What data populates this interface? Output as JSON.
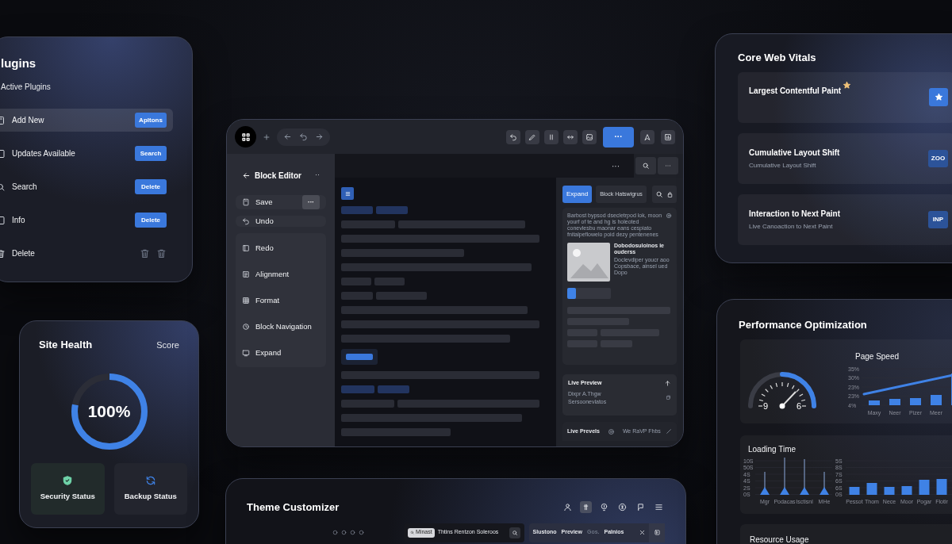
{
  "plugins": {
    "title": "lugins",
    "subtitle": "Active Plugins",
    "rows": [
      {
        "label": "Add New",
        "selected": true,
        "action": "Apltons"
      },
      {
        "label": "Updates Available",
        "selected": false,
        "action": "Search"
      },
      {
        "label": "Search",
        "selected": false,
        "action": "Delete"
      },
      {
        "label": "Info",
        "selected": false,
        "action": "Delete"
      },
      {
        "label": "Delete",
        "selected": false,
        "kind": "trash"
      }
    ]
  },
  "site_health": {
    "title": "Site Health",
    "score_label": "Score",
    "score": "100%",
    "tiles": [
      {
        "label": "Security Status",
        "kind": "security"
      },
      {
        "label": "Backup Status",
        "kind": "backup"
      }
    ]
  },
  "editor": {
    "toolbar_primary": "···",
    "sidebar": {
      "title": "Block Editor",
      "menu": "··",
      "groups": [
        [
          {
            "label": "Save",
            "more": "···"
          }
        ],
        [
          {
            "label": "Undo"
          }
        ],
        [
          {
            "label": "Redo"
          },
          {
            "label": "Alignment"
          },
          {
            "label": "Format"
          },
          {
            "label": "Block Navigation"
          },
          {
            "label": "Expand"
          }
        ]
      ]
    },
    "canvas_menu": "···",
    "inspector": {
      "tabs": [
        {
          "label": "Expand",
          "selected": true
        },
        {
          "label": "Block Hatswigrus",
          "selected": false
        }
      ],
      "description": "Barbost bypsod dsecletrpod lok, moon yourf of te and hg is holeoted conevlesbu maonar eans cespiato fnitalpeflowelo poid dezy pentenenes",
      "media_title": "Dobodosuloinos ie ouderss",
      "media_text": "Doclevdiper youcr aoo Copsbace, ainsel ued Dopo",
      "level": 0.2,
      "live_preview": {
        "title": "Live Preview",
        "lines": [
          "Dixpr A.Thgw",
          "Sersoonevlatos"
        ]
      },
      "footer": [
        "Live Prevels",
        "We RaVP Fhbs"
      ]
    }
  },
  "theme_customizer": {
    "title": "Theme Customizer",
    "search_chip": "Minast",
    "search_text": "Thtins Rentzon Soleroos",
    "links": [
      {
        "label": "Slustono",
        "disabled": false
      },
      {
        "label": "Preview",
        "disabled": false
      },
      {
        "label": "Gos.",
        "disabled": true
      },
      {
        "label": "Palnios",
        "disabled": false
      }
    ]
  },
  "core_web_vitals": {
    "title": "Core Web Vitals",
    "metrics": [
      {
        "name": "Largest Contentful Paint",
        "kind": "star"
      },
      {
        "name": "Cumulative Layout Shift",
        "detail": "Cumulative Layout Shift",
        "badge": "ZOO",
        "kind": "badge"
      },
      {
        "name": "Interaction to Next Paint",
        "detail": "Live Canoaction to Next Paint",
        "badge": "INP",
        "kind": "badge"
      }
    ]
  },
  "performance": {
    "title": "Performance Optimization",
    "gauge": {
      "min_label": "9",
      "max_label": "6"
    },
    "page_speed": {
      "title": "Page Speed",
      "y_labels": [
        "35%",
        "30%",
        "23%",
        "23%",
        "4%"
      ],
      "x_labels": [
        "Maxy",
        "Neer",
        "Pizer",
        "Meer"
      ]
    },
    "loading_time": {
      "title": "Loading Time",
      "left": {
        "y_labels": [
          "10S",
          "50S",
          "4S",
          "4S",
          "2S",
          "0S"
        ],
        "x_labels": [
          "Mgr",
          "Podacas",
          "Isctisnl",
          "MHe"
        ]
      },
      "right": {
        "y_labels": [
          "5S",
          "8S",
          "7S",
          "6S",
          "6S",
          "0S"
        ],
        "x_labels": [
          "Pessot",
          "Thom",
          "Nece",
          "Moor",
          "Pogar",
          "Flotir"
        ]
      }
    },
    "resource_usage": {
      "title": "Resource Usage"
    }
  }
}
